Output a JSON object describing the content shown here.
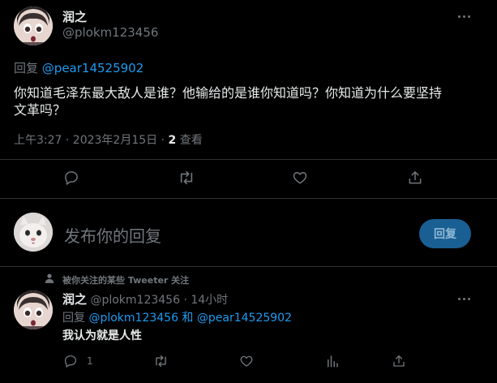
{
  "main_tweet": {
    "display_name": "润之",
    "handle": "@plokm123456",
    "reply_prefix": "回复",
    "reply_to": "@pear14525902",
    "text_line1": "你知道毛泽东最大敌人是谁？他输给的是谁你知道吗？你知道为什么要坚持",
    "text_line2": "文革吗？",
    "timestamp": "上午3:27 · 2023年2月15日 · ",
    "views_count": "2",
    "views_label": " 查看"
  },
  "composer": {
    "placeholder": "发布你的回复",
    "reply_button": "回复"
  },
  "reply_tweet": {
    "social_context": "被你关注的某些 Tweeter 关注",
    "display_name": "润之",
    "handle_time": "@plokm123456 · 14小时",
    "reply_prefix": "回复",
    "reply_to_1": "@plokm123456",
    "reply_and": " 和 ",
    "reply_to_2": "@pear14525902",
    "text": "我认为就是人性",
    "reply_count": "1"
  },
  "colors": {
    "background": "#000000",
    "text": "#e7e9ea",
    "muted": "#71767b",
    "link": "#1d9bf0",
    "reply_button_bg": "#1a5f93"
  },
  "icons": [
    "more-icon",
    "reply-icon",
    "retweet-icon",
    "like-icon",
    "share-icon",
    "views-icon",
    "person-icon"
  ]
}
